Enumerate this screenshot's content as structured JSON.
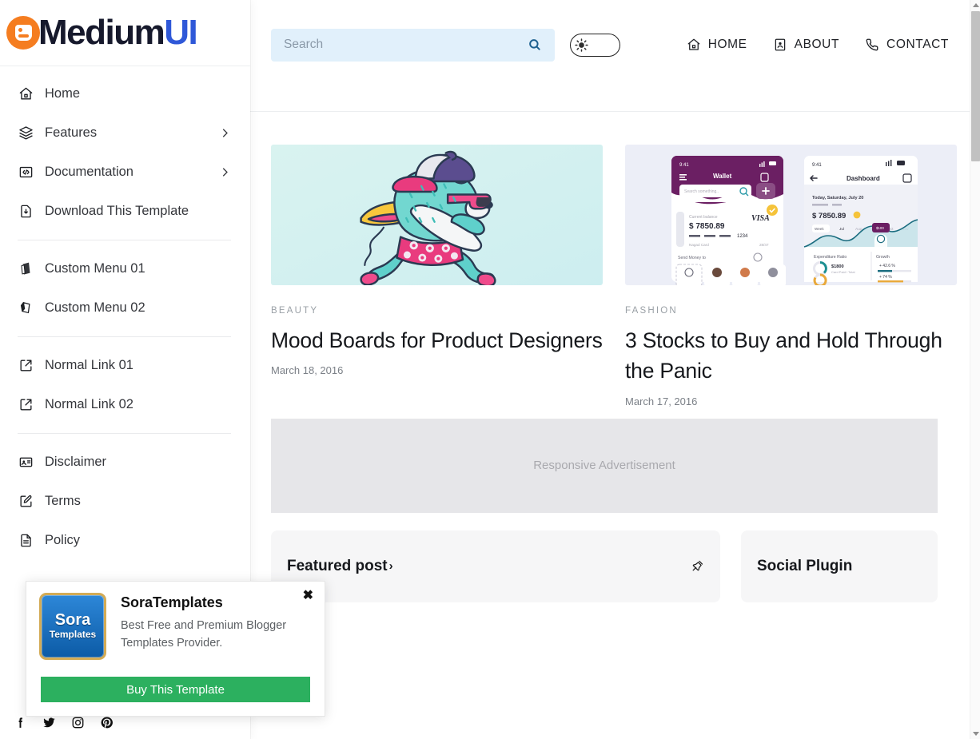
{
  "brand": {
    "name_primary": "Medium",
    "name_secondary": "UI",
    "icon": "blogger-b-icon"
  },
  "sidebar": {
    "items": [
      {
        "label": "Home",
        "icon": "home-icon",
        "has_chevron": false
      },
      {
        "label": "Features",
        "icon": "layers-icon",
        "has_chevron": true
      },
      {
        "label": "Documentation",
        "icon": "code-icon",
        "has_chevron": true
      },
      {
        "label": "Download This Template",
        "icon": "download-file-icon",
        "has_chevron": false
      },
      {
        "label": "Custom Menu 01",
        "icon": "custom-menu-01-icon",
        "has_chevron": false
      },
      {
        "label": "Custom Menu 02",
        "icon": "custom-menu-02-icon",
        "has_chevron": false
      },
      {
        "label": "Normal Link 01",
        "icon": "external-link-icon",
        "has_chevron": false
      },
      {
        "label": "Normal Link 02",
        "icon": "external-link-icon",
        "has_chevron": false
      },
      {
        "label": "Disclaimer",
        "icon": "id-card-icon",
        "has_chevron": false
      },
      {
        "label": "Terms",
        "icon": "edit-square-icon",
        "has_chevron": false
      },
      {
        "label": "Policy",
        "icon": "document-icon",
        "has_chevron": false
      }
    ],
    "social_icons": [
      "facebook-icon",
      "twitter-icon",
      "instagram-icon",
      "pinterest-icon"
    ]
  },
  "header": {
    "search": {
      "value": "",
      "placeholder": "Search",
      "icon": "search-icon"
    },
    "theme_toggle": {
      "icon": "sun-icon",
      "state": "light"
    },
    "nav": [
      {
        "label": "HOME",
        "icon": "home-icon"
      },
      {
        "label": "ABOUT",
        "icon": "contact-card-icon"
      },
      {
        "label": "CONTACT",
        "icon": "phone-icon"
      }
    ]
  },
  "main": {
    "posts": [
      {
        "category": "BEAUTY",
        "title": "Mood Boards for Product Designers",
        "date": "March 18, 2016",
        "thumb": "surfing-bear-illustration"
      },
      {
        "category": "FASHION",
        "title": "3 Stocks to Buy and Hold Through the Panic",
        "date": "March 17, 2016",
        "thumb": "mobile-wallet-app-mockup"
      }
    ],
    "advertisement": {
      "text": "Responsive Advertisement"
    },
    "featured": {
      "title": "Featured post",
      "chevron": "›",
      "icon": "pin-icon"
    },
    "social_plugin": {
      "title": "Social Plugin"
    }
  },
  "popup": {
    "logo_line1": "Sora",
    "logo_line2": "Templates",
    "title": "SoraTemplates",
    "description": "Best Free and Premium Blogger Templates Provider.",
    "button_label": "Buy This Template",
    "close_icon": "✖"
  },
  "colors": {
    "brand_orange": "#f57d20",
    "brand_blue": "#2f58d8",
    "search_bg": "#e1f0fb",
    "buy_button_green": "#2cb05f",
    "ad_bg": "#e6e6e9"
  }
}
